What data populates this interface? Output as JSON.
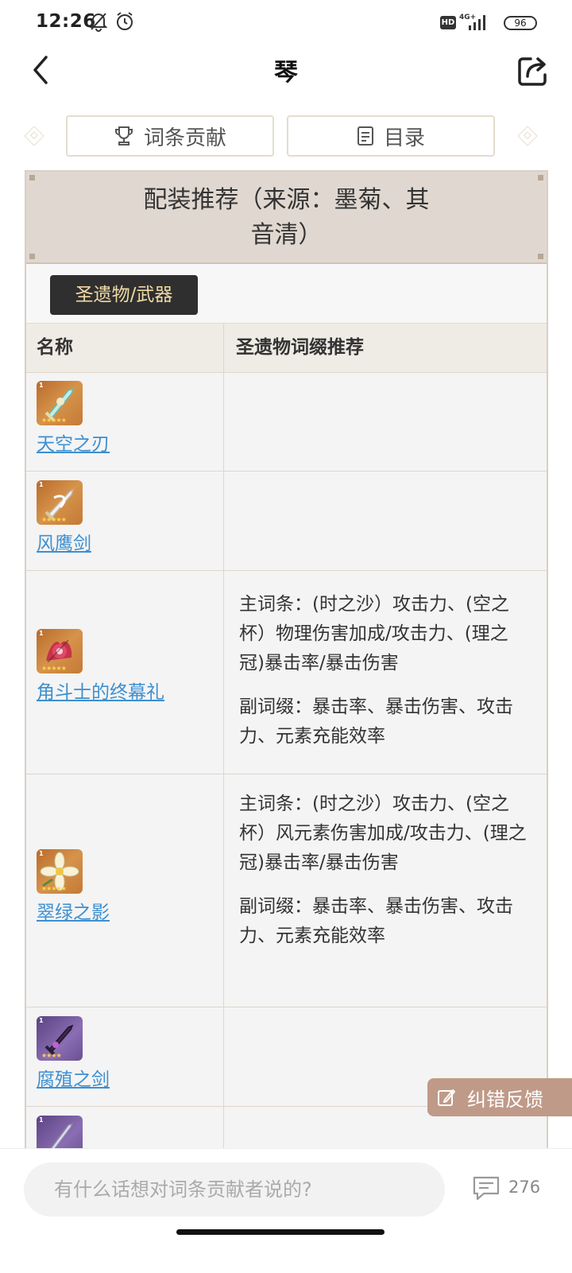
{
  "status": {
    "time": "12:26",
    "hd": "HD",
    "network": "4G+",
    "battery": "96"
  },
  "header": {
    "title": "琴"
  },
  "tabs": [
    {
      "label": "词条贡献",
      "icon": "trophy-icon"
    },
    {
      "label": "目录",
      "icon": "document-icon"
    }
  ],
  "section": {
    "title_line1": "配装推荐（来源：墨菊、其",
    "title_line2": "音清）",
    "filter_pill": "圣遗物/武器",
    "columns": [
      "名称",
      "圣遗物词缀推荐"
    ],
    "rows": [
      {
        "name": "天空之刃",
        "icon": "sword-icon",
        "rarity": "5",
        "desc": []
      },
      {
        "name": "风鹰剑",
        "icon": "sword-icon",
        "rarity": "5",
        "desc": []
      },
      {
        "name": "角斗士的终幕礼",
        "icon": "flower-artifact-icon",
        "rarity": "5",
        "desc": [
          "主词条：(时之沙）攻击力、(空之杯）物理伤害加成/攻击力、(理之冠)暴击率/暴击伤害",
          "副词缀：暴击率、暴击伤害、攻击力、元素充能效率"
        ]
      },
      {
        "name": "翠绿之影",
        "icon": "flower-artifact-icon",
        "rarity": "5",
        "desc": [
          "主词条：(时之沙）攻击力、(空之杯）风元素伤害加成/攻击力、(理之冠)暴击率/暴击伤害",
          "副词缀：暴击率、暴击伤害、攻击力、元素充能效率"
        ]
      },
      {
        "name": "腐殖之剑",
        "icon": "sword-icon",
        "rarity": "4",
        "desc": []
      },
      {
        "name": "",
        "icon": "sword-icon",
        "rarity": "4",
        "desc": []
      }
    ]
  },
  "feedback": {
    "label": "纠错反馈"
  },
  "comment": {
    "placeholder": "有什么话想对词条贡献者说的?",
    "count": "276"
  },
  "colors": {
    "accent_link": "#3d8fd0",
    "header_bg": "#e0d8d0",
    "pill_bg": "#2f2f2f",
    "pill_text": "#f0d9a6",
    "feedback_bg": "#c09a88"
  }
}
